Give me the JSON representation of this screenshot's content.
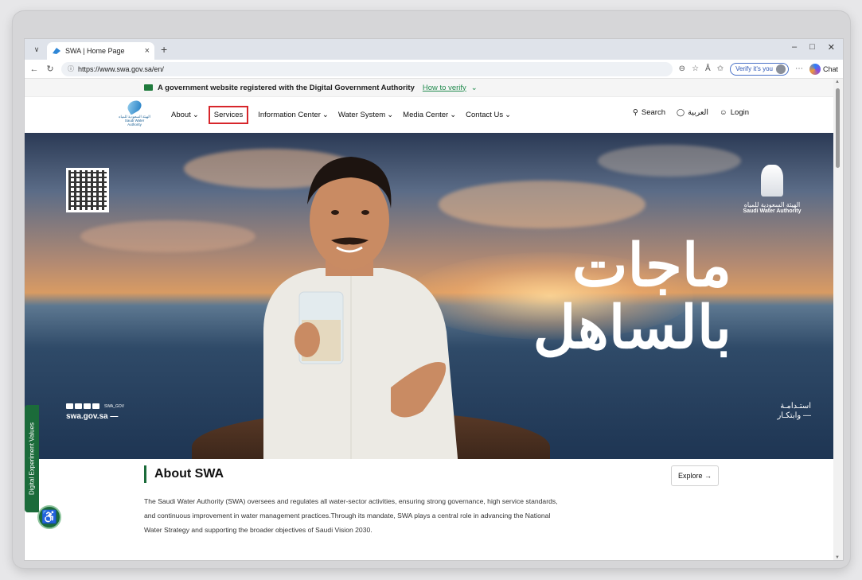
{
  "browser": {
    "tab_title": "SWA | Home Page",
    "new_tab": "+",
    "url": "https://www.swa.gov.sa/en/",
    "verify_label": "Verify it's you",
    "chat_label": "Chat",
    "window_controls": [
      "–",
      "□",
      "✕"
    ]
  },
  "gov_banner": {
    "text": "A government website registered with the Digital Government Authority",
    "link": "How to verify"
  },
  "nav": {
    "logo_text": "الهيئة السعودية للمياه Saudi Water Authority",
    "items": [
      {
        "label": "About",
        "has_dropdown": true
      },
      {
        "label": "Services",
        "has_dropdown": false,
        "active": true
      },
      {
        "label": "Information Center",
        "has_dropdown": true
      },
      {
        "label": "Water System",
        "has_dropdown": true
      },
      {
        "label": "Media Center",
        "has_dropdown": true
      },
      {
        "label": "Contact Us",
        "has_dropdown": true
      }
    ],
    "search_label": "Search",
    "language_label": "العربية",
    "login_label": "Login",
    "accent_color": "#d7262b"
  },
  "hero": {
    "logo_ar": "الهيئة السعودية للمياه",
    "logo_en": "Saudi Water Authority",
    "calligraphy_line1": "ماجات",
    "calligraphy_line2": "بالساهل",
    "social_handle": "SWA_GOV",
    "domain": "swa.gov.sa —",
    "sustain_line1": "استـدامـة",
    "sustain_line2": "وابتكـار —"
  },
  "side_tab": "Digital Experiment Values",
  "about": {
    "title": "About SWA",
    "explore_label": "Explore →",
    "body": "The Saudi Water Authority (SWA) oversees and regulates all water-sector activities, ensuring strong governance, high service standards, and continuous improvement in water management practices.Through its mandate, SWA plays a central role in advancing the National Water Strategy and supporting the broader objectives of Saudi Vision 2030."
  },
  "colors": {
    "brand_green": "#1b6b3a",
    "link_green": "#1f8a4c"
  }
}
